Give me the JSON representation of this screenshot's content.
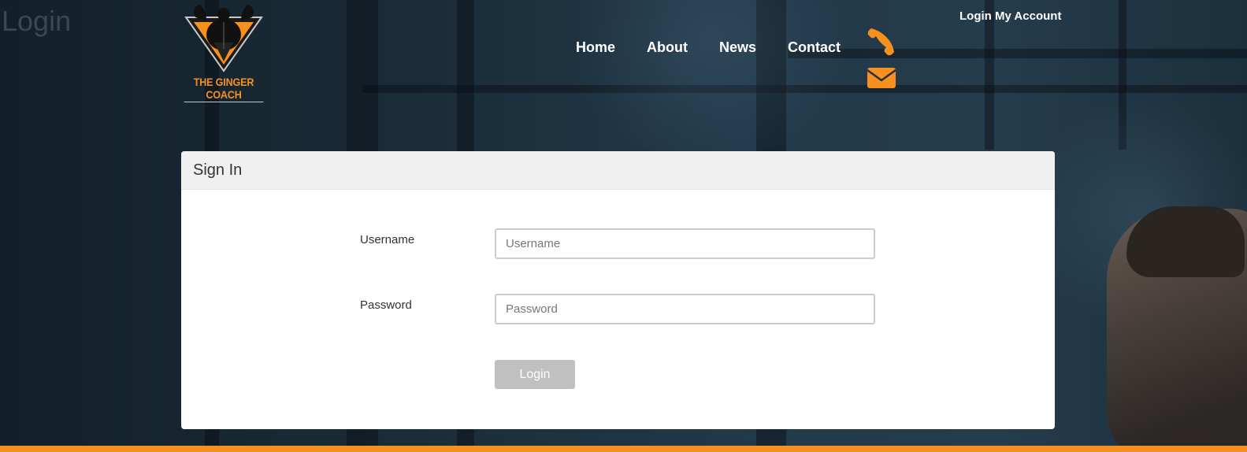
{
  "page": {
    "heading": "Login"
  },
  "brand": {
    "name": "THE GINGER COACH",
    "accent_color": "#f7901e"
  },
  "nav": {
    "items": [
      {
        "label": "Home"
      },
      {
        "label": "About"
      },
      {
        "label": "News"
      },
      {
        "label": "Contact"
      }
    ],
    "account_link": "Login My Account"
  },
  "contact_icons": [
    "phone-icon",
    "envelope-icon"
  ],
  "signin": {
    "title": "Sign In",
    "username_label": "Username",
    "username_placeholder": "Username",
    "username_value": "",
    "password_label": "Password",
    "password_placeholder": "Password",
    "password_value": "",
    "login_label": "Login"
  }
}
